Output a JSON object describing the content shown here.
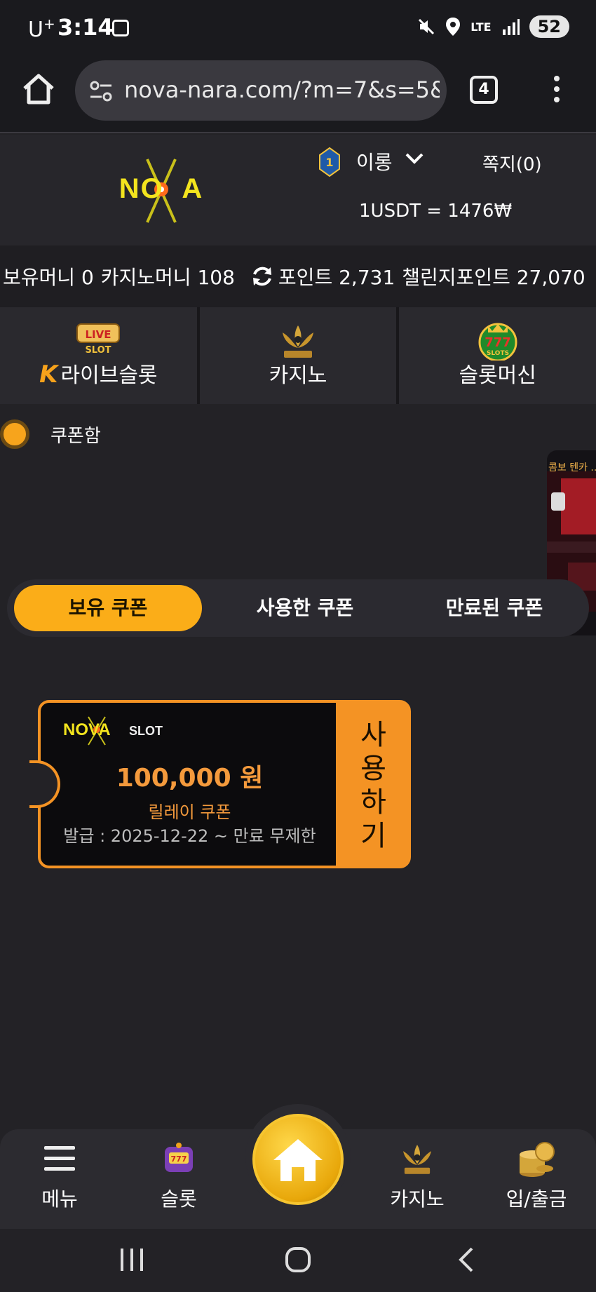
{
  "status_bar": {
    "carrier": "U",
    "carrier_sup": "+",
    "time": "3:14",
    "network": "LTE",
    "battery": "52"
  },
  "browser": {
    "url": "nova-nara.com/?m=7&s=5&",
    "tab_count": "4"
  },
  "header": {
    "logo_text": "NOVA",
    "rank": "1",
    "user_name": "이롱",
    "messages": "쪽지(0)",
    "rate": "1USDT = 1476₩"
  },
  "balances": {
    "hold_money": "보유머니 0",
    "casino_money": "카지노머니 108",
    "points": "포인트 2,731",
    "challenge_points": "챌린지포인트 27,070"
  },
  "game_nav": [
    {
      "label": "라이브슬롯",
      "icon": "live-slot-icon",
      "prefix": "K"
    },
    {
      "label": "카지노",
      "icon": "k-slot-lotus-icon"
    },
    {
      "label": "슬롯머신",
      "icon": "777-slots-icon"
    }
  ],
  "coupon_section": {
    "title": "쿠폰함",
    "side_banner_text": "콤보 텐카 ..."
  },
  "tabs": [
    {
      "label": "보유 쿠폰",
      "active": true
    },
    {
      "label": "사용한 쿠폰",
      "active": false
    },
    {
      "label": "만료된 쿠폰",
      "active": false
    }
  ],
  "coupon": {
    "brand": "NOVA",
    "brand_suffix": "SLOT",
    "amount": "100,000 원",
    "type": "릴레이 쿠폰",
    "dates": "발급 : 2025-12-22 ~ 만료 무제한",
    "use_label": [
      "사",
      "용",
      "하",
      "기"
    ]
  },
  "bottom_nav": [
    {
      "label": "메뉴",
      "icon": "hamburger-icon"
    },
    {
      "label": "슬롯",
      "icon": "slot-machine-icon"
    },
    {
      "label": "카지노",
      "icon": "k-slot-lotus-icon"
    },
    {
      "label": "입/출금",
      "icon": "coins-icon"
    }
  ],
  "colors": {
    "accent": "#fbad18",
    "coupon_orange": "#f49324",
    "background": "#232226"
  }
}
